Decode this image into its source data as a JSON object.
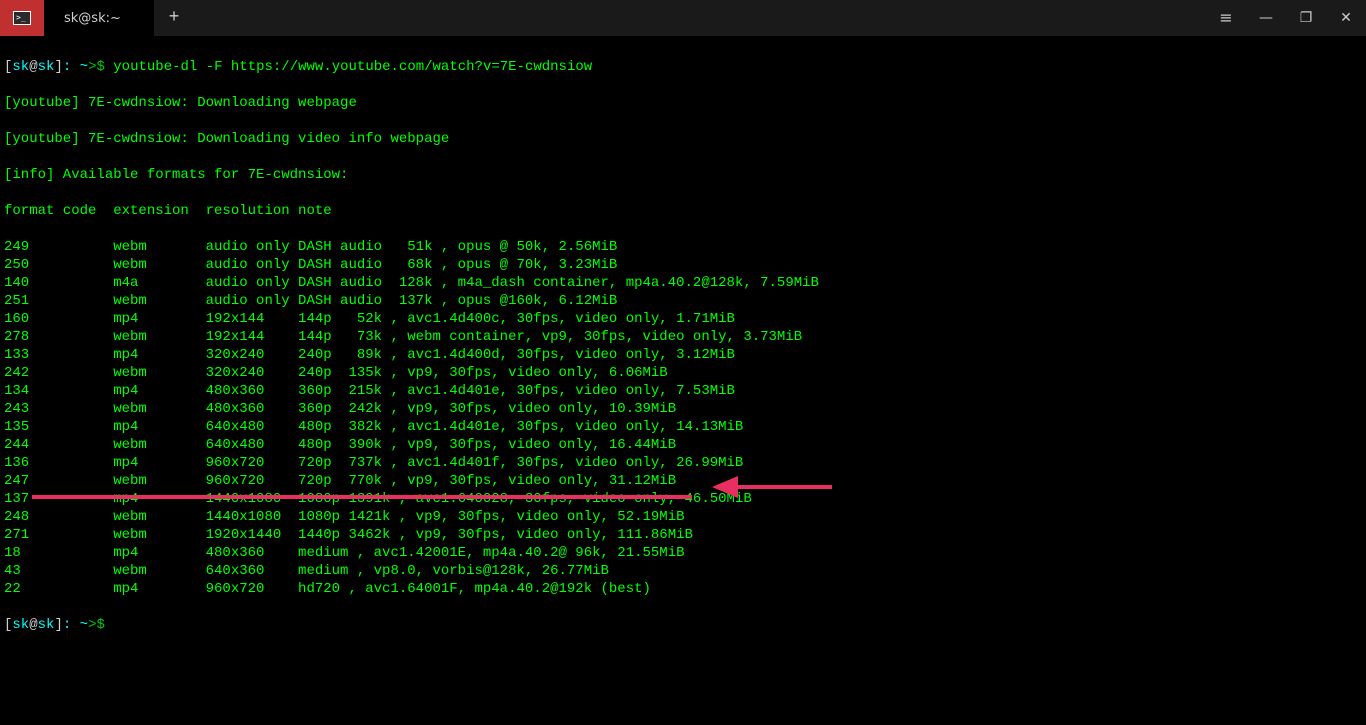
{
  "titlebar": {
    "tab_title": "sk@sk:~",
    "new_tab": "+",
    "menu": "≡",
    "minimize": "—",
    "maximize": "❐",
    "close": "✕"
  },
  "prompt": {
    "open": "[",
    "user": "sk",
    "at": "@",
    "host": "sk",
    "close": "]",
    "path": ": ~",
    "ps1": ">$ "
  },
  "command": "youtube-dl -F https://www.youtube.com/watch?v=7E-cwdnsiow",
  "output": {
    "line1": "[youtube] 7E-cwdnsiow: Downloading webpage",
    "line2": "[youtube] 7E-cwdnsiow: Downloading video info webpage",
    "line3": "[info] Available formats for 7E-cwdnsiow:",
    "header": "format code  extension  resolution note"
  },
  "formats": [
    {
      "code": "249",
      "ext": "webm",
      "res": "audio only",
      "note": "DASH audio   51k , opus @ 50k, 2.56MiB"
    },
    {
      "code": "250",
      "ext": "webm",
      "res": "audio only",
      "note": "DASH audio   68k , opus @ 70k, 3.23MiB"
    },
    {
      "code": "140",
      "ext": "m4a",
      "res": "audio only",
      "note": "DASH audio  128k , m4a_dash container, mp4a.40.2@128k, 7.59MiB"
    },
    {
      "code": "251",
      "ext": "webm",
      "res": "audio only",
      "note": "DASH audio  137k , opus @160k, 6.12MiB"
    },
    {
      "code": "160",
      "ext": "mp4",
      "res": "192x144",
      "note": "144p   52k , avc1.4d400c, 30fps, video only, 1.71MiB"
    },
    {
      "code": "278",
      "ext": "webm",
      "res": "192x144",
      "note": "144p   73k , webm container, vp9, 30fps, video only, 3.73MiB"
    },
    {
      "code": "133",
      "ext": "mp4",
      "res": "320x240",
      "note": "240p   89k , avc1.4d400d, 30fps, video only, 3.12MiB"
    },
    {
      "code": "242",
      "ext": "webm",
      "res": "320x240",
      "note": "240p  135k , vp9, 30fps, video only, 6.06MiB"
    },
    {
      "code": "134",
      "ext": "mp4",
      "res": "480x360",
      "note": "360p  215k , avc1.4d401e, 30fps, video only, 7.53MiB"
    },
    {
      "code": "243",
      "ext": "webm",
      "res": "480x360",
      "note": "360p  242k , vp9, 30fps, video only, 10.39MiB"
    },
    {
      "code": "135",
      "ext": "mp4",
      "res": "640x480",
      "note": "480p  382k , avc1.4d401e, 30fps, video only, 14.13MiB"
    },
    {
      "code": "244",
      "ext": "webm",
      "res": "640x480",
      "note": "480p  390k , vp9, 30fps, video only, 16.44MiB"
    },
    {
      "code": "136",
      "ext": "mp4",
      "res": "960x720",
      "note": "720p  737k , avc1.4d401f, 30fps, video only, 26.99MiB"
    },
    {
      "code": "247",
      "ext": "webm",
      "res": "960x720",
      "note": "720p  770k , vp9, 30fps, video only, 31.12MiB"
    },
    {
      "code": "137",
      "ext": "mp4",
      "res": "1440x1080",
      "note": "1080p 1391k , avc1.640028, 30fps, video only, 46.50MiB"
    },
    {
      "code": "248",
      "ext": "webm",
      "res": "1440x1080",
      "note": "1080p 1421k , vp9, 30fps, video only, 52.19MiB"
    },
    {
      "code": "271",
      "ext": "webm",
      "res": "1920x1440",
      "note": "1440p 3462k , vp9, 30fps, video only, 111.86MiB"
    },
    {
      "code": "18",
      "ext": "mp4",
      "res": "480x360",
      "note": "medium , avc1.42001E, mp4a.40.2@ 96k, 21.55MiB"
    },
    {
      "code": "43",
      "ext": "webm",
      "res": "640x360",
      "note": "medium , vp8.0, vorbis@128k, 26.77MiB"
    },
    {
      "code": "22",
      "ext": "mp4",
      "res": "960x720",
      "note": "hd720 , avc1.64001F, mp4a.40.2@192k (best)"
    }
  ]
}
